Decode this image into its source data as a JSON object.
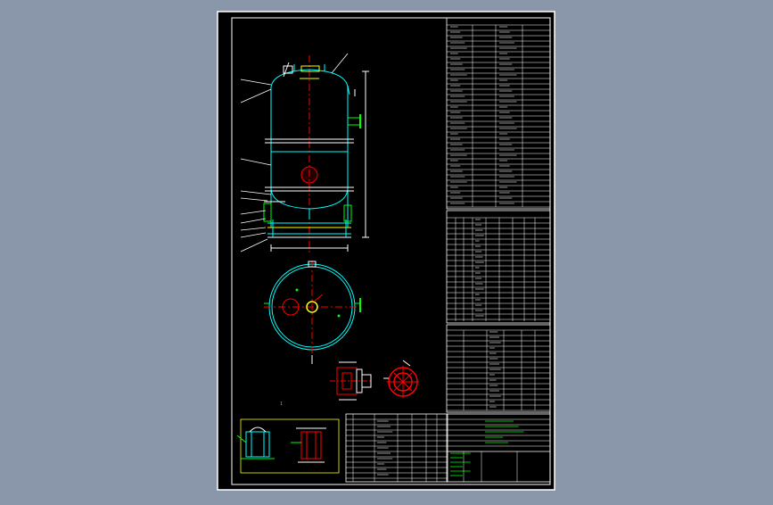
{
  "drawing": {
    "background_color": "#8a97ab",
    "sheet_color": "#000000",
    "frame_color": "#ffffff",
    "pipe_color": "#00ffff",
    "centerline_color": "#ff0000",
    "dimension_color": "#00ff00",
    "text_color": "#ffffff",
    "highlight_color": "#ffff00"
  },
  "views": {
    "detail_marker": "1"
  }
}
